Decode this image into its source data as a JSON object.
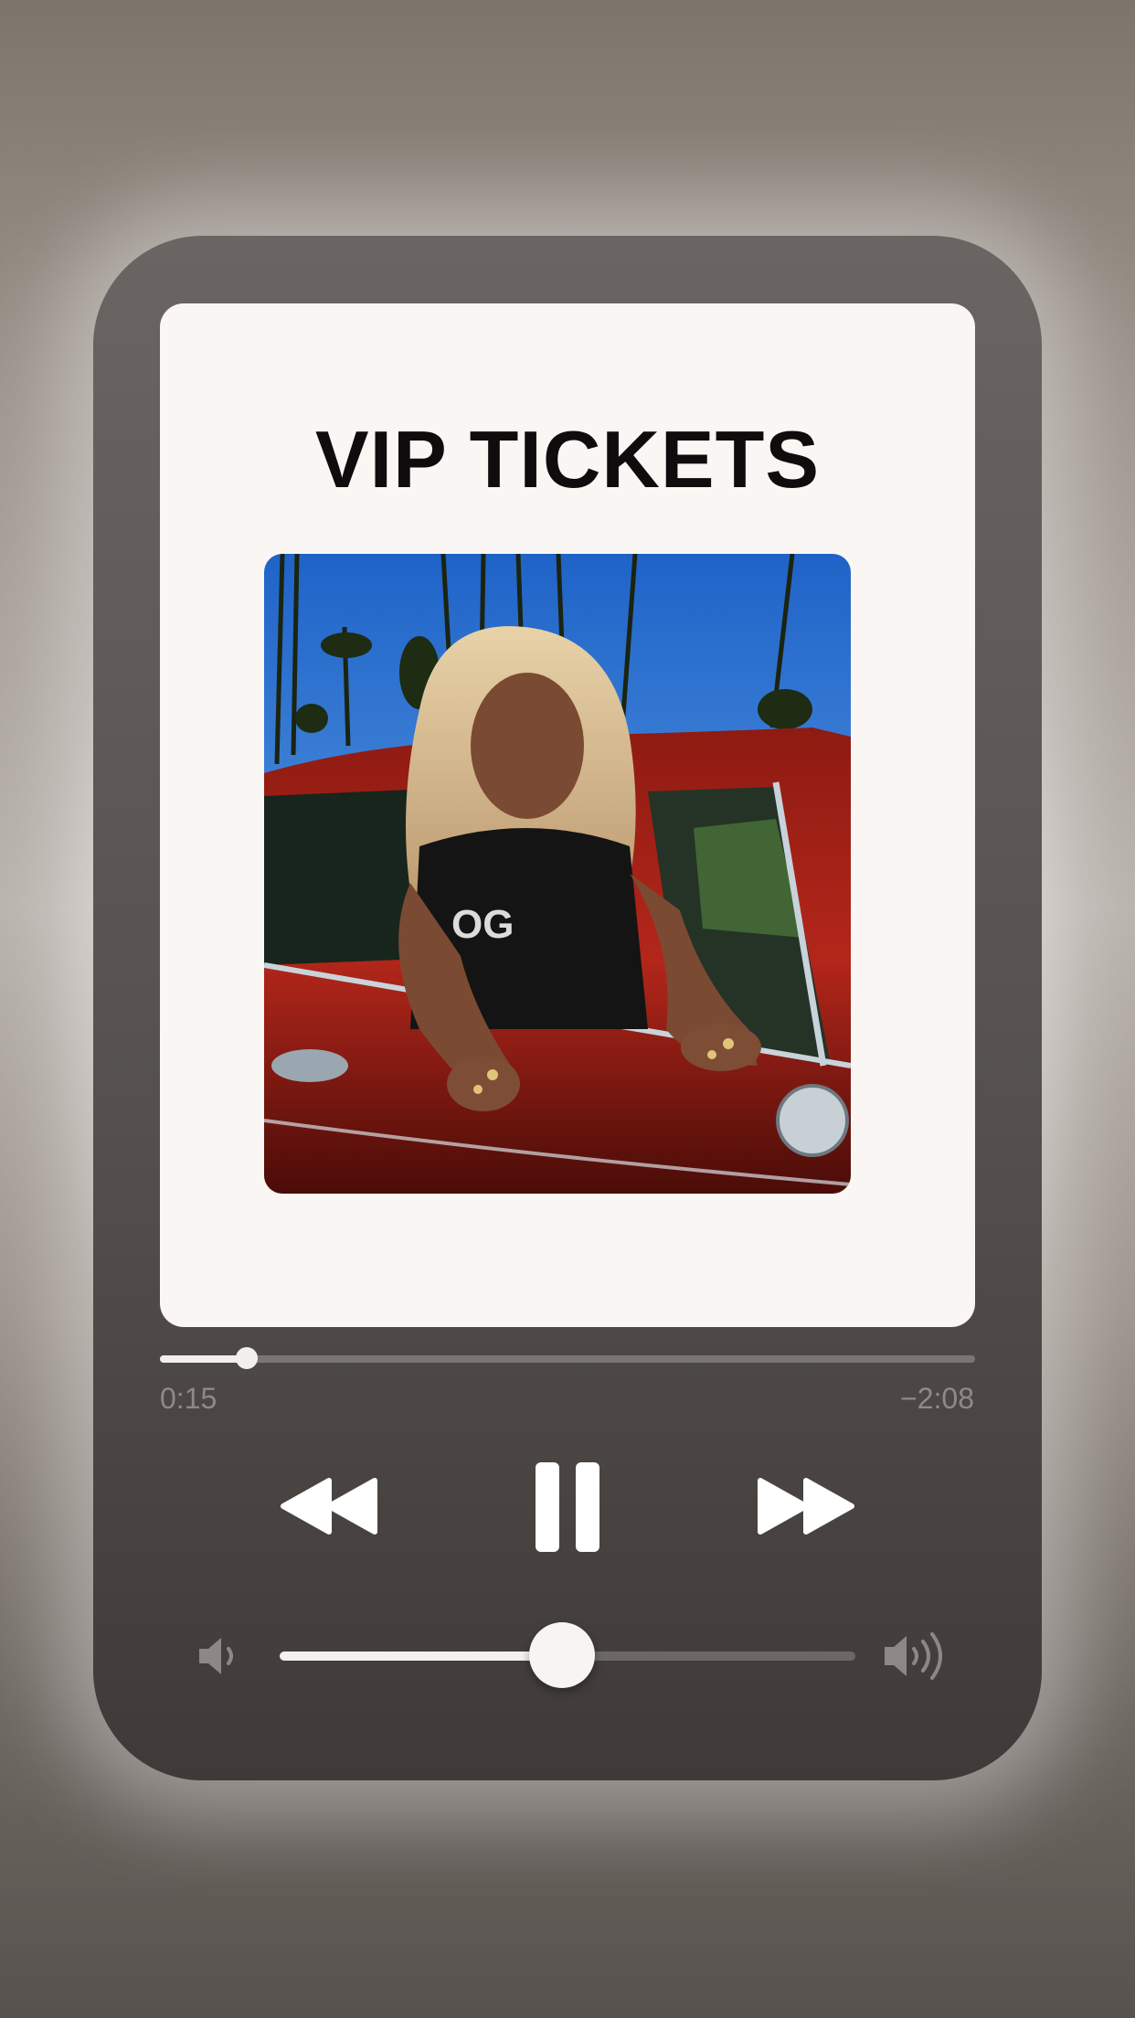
{
  "card": {
    "title": "VIP TICKETS"
  },
  "artwork": {
    "description_icon": "album-art-image"
  },
  "playback": {
    "elapsed": "0:15",
    "remaining": "−2:08",
    "progress_fraction": 0.107
  },
  "controls": {
    "rewind_icon": "rewind-icon",
    "pause_icon": "pause-icon",
    "fast_forward_icon": "fast-forward-icon"
  },
  "volume": {
    "level_fraction": 0.49,
    "min_icon": "speaker-low-icon",
    "max_icon": "speaker-high-icon"
  },
  "colors": {
    "card_background": "#f9f6f4",
    "player_background": "#56514f",
    "title_text": "#0e0c0c",
    "time_text": "#8f8a87",
    "control_white": "#ffffff"
  }
}
